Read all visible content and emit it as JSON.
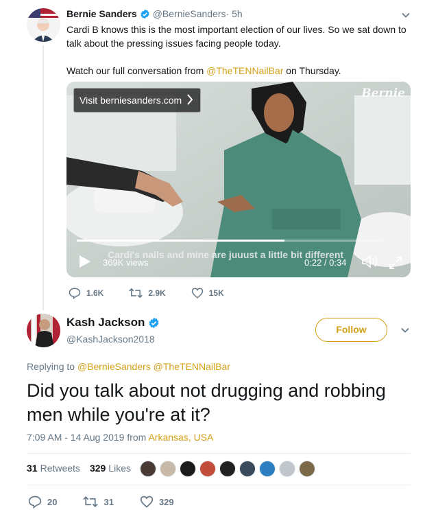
{
  "parent_tweet": {
    "name": "Bernie Sanders",
    "handle": "@BernieSanders",
    "time": " · 5h",
    "text_line1": "Cardi B knows this is the most important election of our lives. So we sat down to talk about the pressing issues facing people today.",
    "text_watch_prefix": "Watch our full conversation from ",
    "text_watch_mention": "@TheTENNailBar",
    "text_watch_suffix": " on Thursday.",
    "video": {
      "visit_label": "Visit berniesanders.com",
      "logo_text": "Bernie",
      "caption": "Cardi's nails and mine are juuust a little bit different",
      "views": "369K views",
      "timecode": "0:22 / 0:34",
      "progress": 0.68
    },
    "actions": {
      "replies": "1.6K",
      "retweets": "2.9K",
      "likes": "15K"
    }
  },
  "main_tweet": {
    "name": "Kash Jackson",
    "handle": "@KashJackson2018",
    "follow_label": "Follow",
    "replying_prefix": "Replying to ",
    "replying_mentions": "@BernieSanders @TheTENNailBar",
    "text": "Did you talk about not drugging and robbing men while you're at it?",
    "time": "7:09 AM - 14 Aug 2019 from ",
    "location": "Arkansas, USA",
    "retweets_count": "31",
    "retweets_label": "Retweets",
    "likes_count": "329",
    "likes_label": "Likes",
    "actions": {
      "replies": "20",
      "retweets": "31",
      "likes": "329"
    }
  },
  "colors": {
    "accent": "#d4a017",
    "text": "#14171a",
    "muted": "#657786",
    "verified": "#1da1f2"
  }
}
